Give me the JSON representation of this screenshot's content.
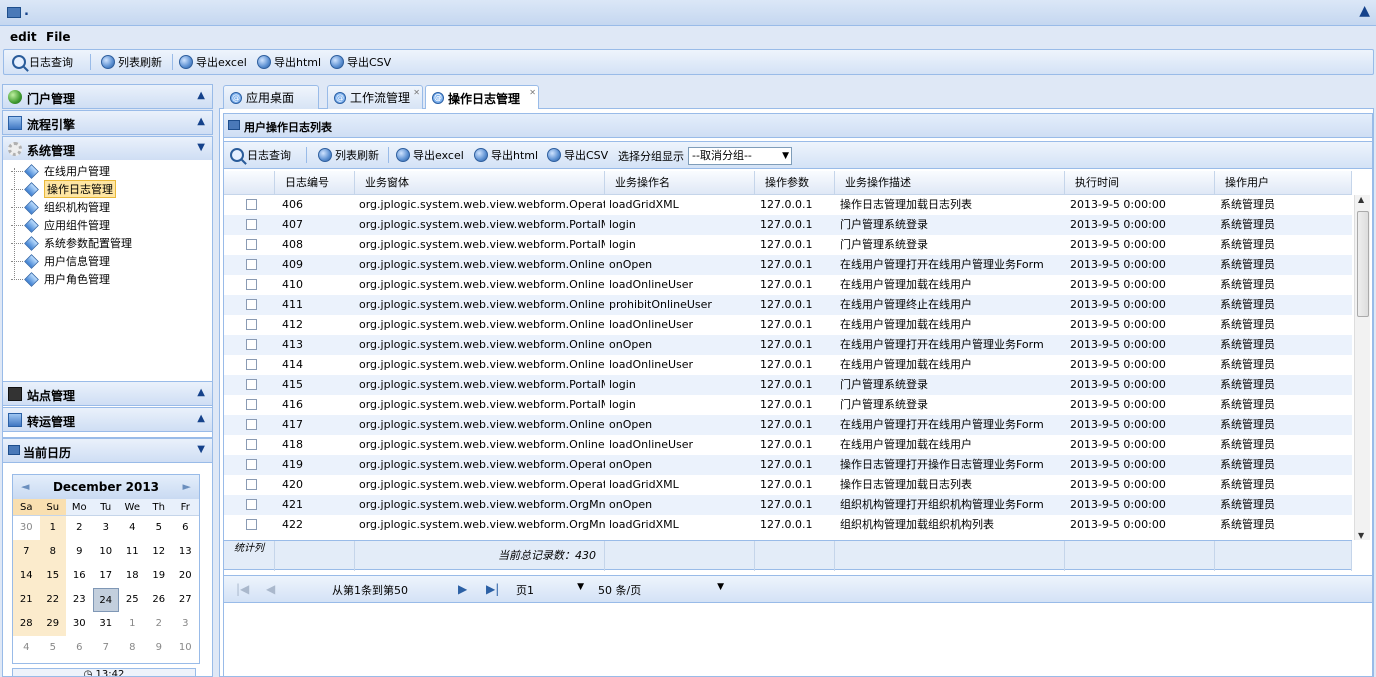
{
  "window": {
    "title": "."
  },
  "menu": {
    "items": [
      "edit",
      "File"
    ]
  },
  "top_toolbar": {
    "buttons": [
      "日志查询",
      "列表刷新",
      "导出excel",
      "导出html",
      "导出CSV"
    ]
  },
  "sidebar": {
    "sections": [
      {
        "label": "门户管理",
        "toggle": "▲",
        "icon": "globe-icon"
      },
      {
        "label": "流程引擎",
        "toggle": "▲",
        "icon": "flow-icon"
      },
      {
        "label": "系统管理",
        "toggle": "▼",
        "icon": "gear-icon"
      }
    ],
    "tree_items": [
      "在线用户管理",
      "操作日志管理",
      "组织机构管理",
      "应用组件管理",
      "系统参数配置管理",
      "用户信息管理",
      "用户角色管理"
    ],
    "selected_item": "操作日志管理",
    "lower_sections": [
      {
        "label": "站点管理",
        "toggle": "▲",
        "icon": "monitor-icon"
      },
      {
        "label": "转运管理",
        "toggle": "▲",
        "icon": "flow-icon"
      }
    ],
    "calendar_panel": {
      "label": "当前日历",
      "toggle": "▼"
    }
  },
  "calendar": {
    "month_title": "December 2013",
    "prev": "◄",
    "next": "►",
    "weekdays": [
      "Sa",
      "Su",
      "Mo",
      "Tu",
      "We",
      "Th",
      "Fr"
    ],
    "weeks": [
      [
        "30",
        "1",
        "2",
        "3",
        "4",
        "5",
        "6"
      ],
      [
        "7",
        "8",
        "9",
        "10",
        "11",
        "12",
        "13"
      ],
      [
        "14",
        "15",
        "16",
        "17",
        "18",
        "19",
        "20"
      ],
      [
        "21",
        "22",
        "23",
        "24",
        "25",
        "26",
        "27"
      ],
      [
        "28",
        "29",
        "30",
        "31",
        "1",
        "2",
        "3"
      ],
      [
        "4",
        "5",
        "6",
        "7",
        "8",
        "9",
        "10"
      ]
    ],
    "today": "24",
    "time": "13:42"
  },
  "tabs": [
    {
      "label": "应用桌面",
      "active": false,
      "closable": false
    },
    {
      "label": "工作流管理",
      "active": false,
      "closable": true
    },
    {
      "label": "操作日志管理",
      "active": true,
      "closable": true
    }
  ],
  "panel": {
    "title": "用户操作日志列表",
    "toolbar": {
      "buttons": [
        "日志查询",
        "列表刷新",
        "导出excel",
        "导出html",
        "导出CSV"
      ],
      "group_label": "选择分组显示",
      "group_value": "--取消分组--"
    }
  },
  "grid": {
    "columns": [
      "日志编号",
      "业务窗体",
      "业务操作名",
      "操作参数",
      "业务操作描述",
      "执行时间",
      "操作用户"
    ],
    "rows": [
      [
        "406",
        "org.jplogic.system.web.view.webform.OperateLogF",
        "loadGridXML",
        "127.0.0.1",
        "操作日志管理加载日志列表",
        "2013-9-5 0:00:00",
        "系统管理员"
      ],
      [
        "407",
        "org.jplogic.system.web.view.webform.PortalMngFo",
        "login",
        "127.0.0.1",
        "门户管理系统登录",
        "2013-9-5 0:00:00",
        "系统管理员"
      ],
      [
        "408",
        "org.jplogic.system.web.view.webform.PortalMngFo",
        "login",
        "127.0.0.1",
        "门户管理系统登录",
        "2013-9-5 0:00:00",
        "系统管理员"
      ],
      [
        "409",
        "org.jplogic.system.web.view.webform.OnlineUserM",
        "onOpen",
        "127.0.0.1",
        "在线用户管理打开在线用户管理业务Form",
        "2013-9-5 0:00:00",
        "系统管理员"
      ],
      [
        "410",
        "org.jplogic.system.web.view.webform.OnlineUserM",
        "loadOnlineUser",
        "127.0.0.1",
        "在线用户管理加载在线用户",
        "2013-9-5 0:00:00",
        "系统管理员"
      ],
      [
        "411",
        "org.jplogic.system.web.view.webform.OnlineUserM",
        "prohibitOnlineUser",
        "127.0.0.1",
        "在线用户管理终止在线用户",
        "2013-9-5 0:00:00",
        "系统管理员"
      ],
      [
        "412",
        "org.jplogic.system.web.view.webform.OnlineUserM",
        "loadOnlineUser",
        "127.0.0.1",
        "在线用户管理加载在线用户",
        "2013-9-5 0:00:00",
        "系统管理员"
      ],
      [
        "413",
        "org.jplogic.system.web.view.webform.OnlineUserM",
        "onOpen",
        "127.0.0.1",
        "在线用户管理打开在线用户管理业务Form",
        "2013-9-5 0:00:00",
        "系统管理员"
      ],
      [
        "414",
        "org.jplogic.system.web.view.webform.OnlineUserM",
        "loadOnlineUser",
        "127.0.0.1",
        "在线用户管理加载在线用户",
        "2013-9-5 0:00:00",
        "系统管理员"
      ],
      [
        "415",
        "org.jplogic.system.web.view.webform.PortalMngFo",
        "login",
        "127.0.0.1",
        "门户管理系统登录",
        "2013-9-5 0:00:00",
        "系统管理员"
      ],
      [
        "416",
        "org.jplogic.system.web.view.webform.PortalMngFo",
        "login",
        "127.0.0.1",
        "门户管理系统登录",
        "2013-9-5 0:00:00",
        "系统管理员"
      ],
      [
        "417",
        "org.jplogic.system.web.view.webform.OnlineUserM",
        "onOpen",
        "127.0.0.1",
        "在线用户管理打开在线用户管理业务Form",
        "2013-9-5 0:00:00",
        "系统管理员"
      ],
      [
        "418",
        "org.jplogic.system.web.view.webform.OnlineUserM",
        "loadOnlineUser",
        "127.0.0.1",
        "在线用户管理加载在线用户",
        "2013-9-5 0:00:00",
        "系统管理员"
      ],
      [
        "419",
        "org.jplogic.system.web.view.webform.OperateLogF",
        "onOpen",
        "127.0.0.1",
        "操作日志管理打开操作日志管理业务Form",
        "2013-9-5 0:00:00",
        "系统管理员"
      ],
      [
        "420",
        "org.jplogic.system.web.view.webform.OperateLogF",
        "loadGridXML",
        "127.0.0.1",
        "操作日志管理加载日志列表",
        "2013-9-5 0:00:00",
        "系统管理员"
      ],
      [
        "421",
        "org.jplogic.system.web.view.webform.OrgMngForn",
        "onOpen",
        "127.0.0.1",
        "组织机构管理打开组织机构管理业务Form",
        "2013-9-5 0:00:00",
        "系统管理员"
      ],
      [
        "422",
        "org.jplogic.system.web.view.webform.OrgMngForn",
        "loadGridXML",
        "127.0.0.1",
        "组织机构管理加载组织机构列表",
        "2013-9-5 0:00:00",
        "系统管理员"
      ]
    ],
    "summary_label": "统计列",
    "summary_text": "当前总记录数：430"
  },
  "pager": {
    "range_text": "从第1条到第50",
    "page_value": "页1",
    "page_size_value": "50 条/页"
  }
}
